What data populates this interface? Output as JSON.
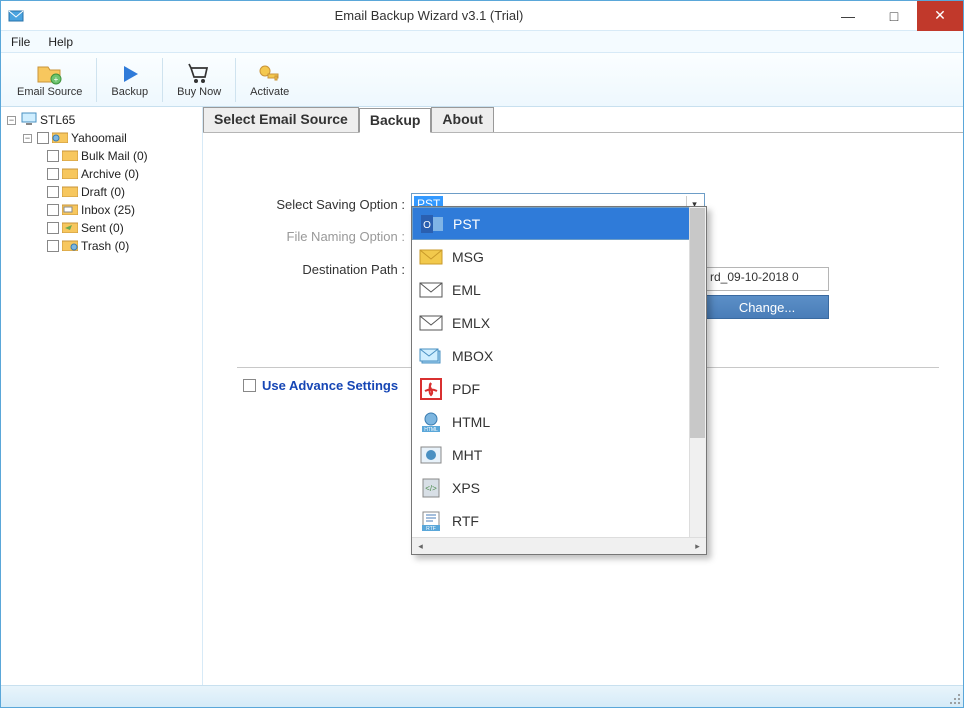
{
  "window": {
    "title": "Email Backup Wizard v3.1 (Trial)"
  },
  "menu": {
    "file": "File",
    "help": "Help"
  },
  "toolbar": {
    "email_source": "Email Source",
    "backup": "Backup",
    "buy_now": "Buy Now",
    "activate": "Activate"
  },
  "tree": {
    "root": "STL65",
    "account": "Yahoomail",
    "folders": [
      {
        "name": "Bulk Mail (0)"
      },
      {
        "name": "Archive (0)"
      },
      {
        "name": "Draft (0)"
      },
      {
        "name": "Inbox (25)"
      },
      {
        "name": "Sent (0)"
      },
      {
        "name": "Trash (0)"
      }
    ]
  },
  "tabs": {
    "source": "Select Email Source",
    "backup": "Backup",
    "about": "About"
  },
  "form": {
    "saving_label": "Select Saving Option  :",
    "saving_value": "PST",
    "naming_label": "File Naming Option  :",
    "dest_label": "Destination Path  :",
    "dest_value": "rd_09-10-2018 0",
    "change": "Change...",
    "advance": "Use Advance Settings"
  },
  "dropdown": {
    "items": [
      "PST",
      "MSG",
      "EML",
      "EMLX",
      "MBOX",
      "PDF",
      "HTML",
      "MHT",
      "XPS",
      "RTF"
    ]
  },
  "icons": {
    "pst_color": "#2a5fb0",
    "msg_color": "#f2c94c",
    "pdf_color": "#d93030"
  }
}
